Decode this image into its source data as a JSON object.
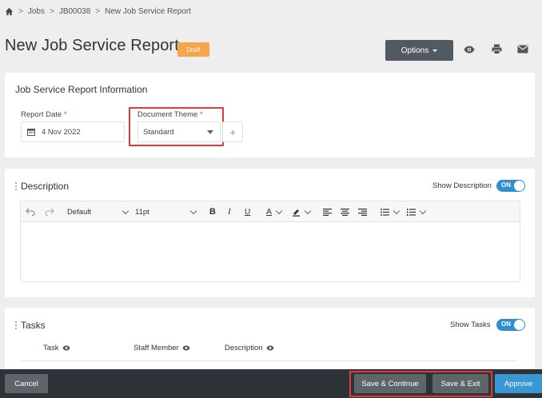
{
  "breadcrumb": {
    "home_icon": "home-icon",
    "items": [
      "Jobs",
      "JB00038",
      "New Job Service Report"
    ],
    "separator": ">"
  },
  "header": {
    "title": "New Job Service Report",
    "status_badge": "Draft",
    "options_label": "Options",
    "icons": [
      "eye-icon",
      "print-icon",
      "mail-icon"
    ]
  },
  "info_card": {
    "title": "Job Service Report Information",
    "report_date_label": "Report Date",
    "report_date_value": "4 Nov 2022",
    "document_theme_label": "Document Theme",
    "document_theme_value": "Standard",
    "required_mark": "*",
    "add_symbol": "+"
  },
  "description_card": {
    "title": "Description",
    "toggle_label": "Show Description",
    "toggle_state": "ON",
    "toolbar": {
      "font_family": "Default",
      "font_size": "11pt",
      "bold": "B",
      "italic": "I",
      "underline": "U",
      "font_color": "A"
    }
  },
  "tasks_card": {
    "title": "Tasks",
    "toggle_label": "Show Tasks",
    "toggle_state": "ON",
    "columns": [
      "Task",
      "Staff Member",
      "Description"
    ]
  },
  "footer": {
    "cancel": "Cancel",
    "save_continue": "Save & Continue",
    "save_exit": "Save & Exit",
    "approve": "Approve"
  },
  "colors": {
    "accent_blue": "#3a97d1",
    "draft_orange": "#f5a64b",
    "highlight_red": "#e03a3a",
    "footer_bg": "#2d3338"
  }
}
